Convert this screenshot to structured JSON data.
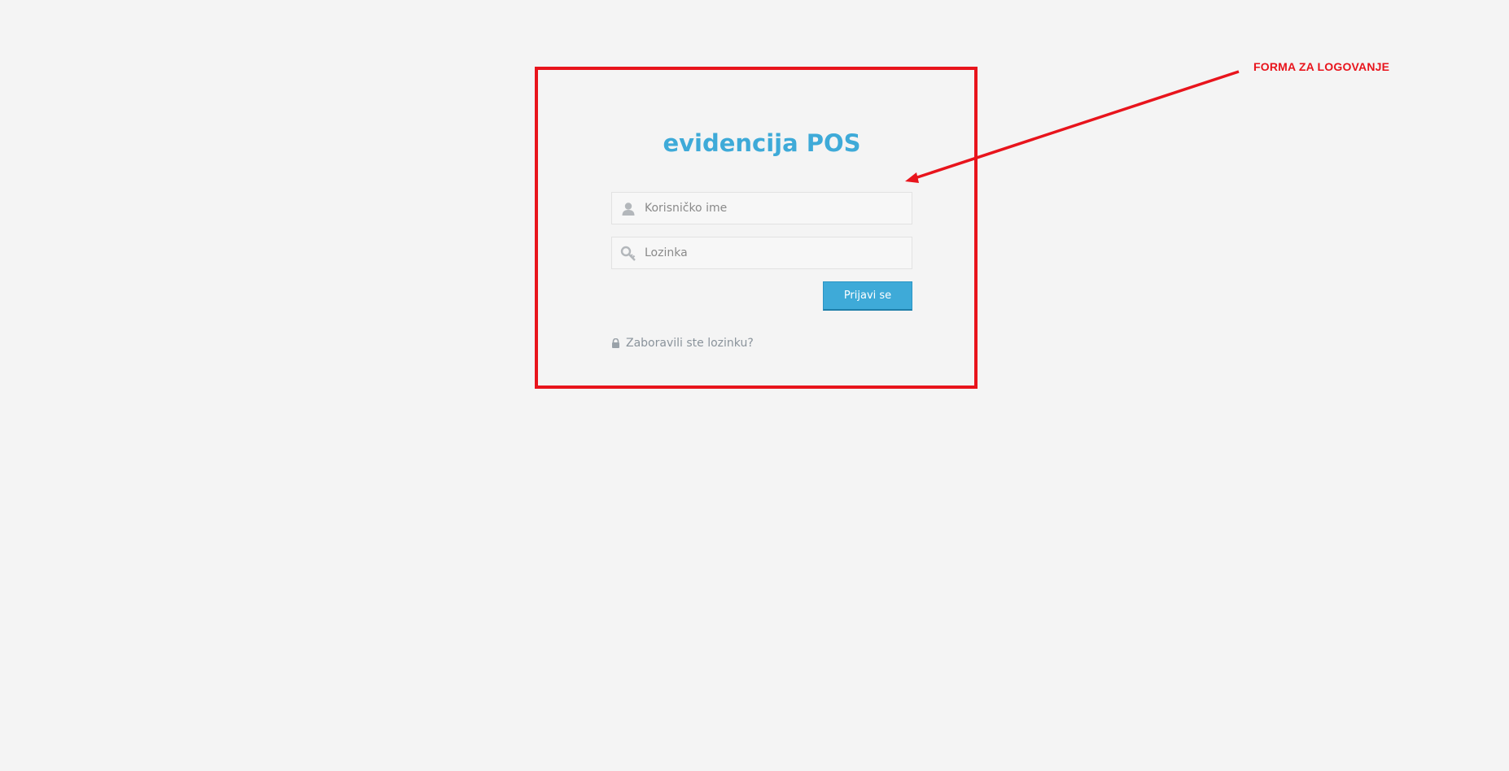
{
  "app": {
    "title": "evidencija POS"
  },
  "form": {
    "username_placeholder": "Korisničko ime",
    "username_value": "",
    "password_placeholder": "Lozinka",
    "password_value": "",
    "login_label": "Prijavi se",
    "forgot_label": "Zaboravili ste lozinku?",
    "icons": {
      "username": "user-icon",
      "password": "key-icon",
      "forgot": "lock-icon"
    }
  },
  "annotation": {
    "label": "FORMA ZA LOGOVANJE",
    "color": "#e8141c"
  },
  "colors": {
    "accent": "#3eaad8",
    "background": "#f4f4f4"
  }
}
